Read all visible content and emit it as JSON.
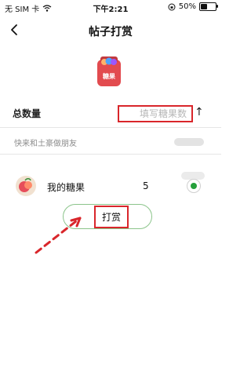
{
  "status_bar": {
    "carrier": "无 SIM 卡",
    "time": "下午2:21",
    "battery": "50%",
    "battery_level": 0.5
  },
  "header": {
    "title": "帖子打赏"
  },
  "candy_badge": {
    "label": "糖果"
  },
  "total": {
    "label": "总数量",
    "input_placeholder": "填写糖果数",
    "input_value": "",
    "send_arrow": "↑"
  },
  "message": {
    "text": "快来和土豪做朋友"
  },
  "balance": {
    "label": "我的糖果",
    "count": "5",
    "selected": true
  },
  "tip_button": {
    "label": "打赏"
  },
  "colors": {
    "accent_green": "#25a03b",
    "annotation_red": "#d9262b"
  }
}
